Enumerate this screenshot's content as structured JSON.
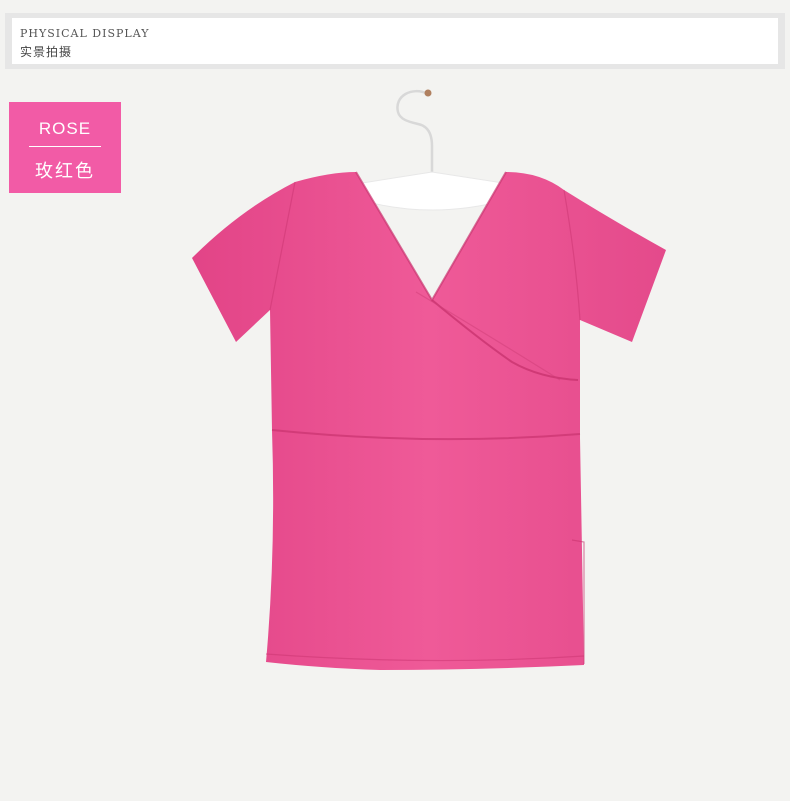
{
  "header": {
    "title_en": "PHYSICAL DISPLAY",
    "title_cn": "实景拍摄"
  },
  "color_tag": {
    "name_en": "ROSE",
    "name_cn": "玫红色",
    "color": "#f25ba6"
  },
  "product": {
    "garment_color": "#ea4f8f",
    "hanger_icon": "hanger-icon"
  }
}
